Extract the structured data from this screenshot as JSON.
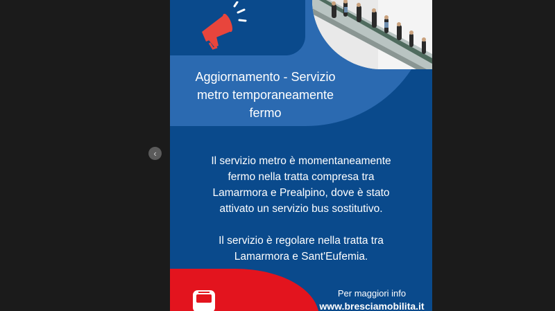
{
  "viewer": {
    "prev_icon": "chevron-left-icon",
    "prev_glyph": "‹"
  },
  "post": {
    "title": "Aggiornamento - Servizio\nmetro temporaneamente\nfermo",
    "body": "Il servizio metro è momentaneamente\nfermo nella tratta compresa tra\nLamarmora e Prealpino, dove è stato\nattivato un servizio bus sostitutivo.\n\nIl servizio è regolare nella tratta tra\nLamarmora e Sant'Eufemia.",
    "info_label": "Per maggiori info",
    "info_url": "www.bresciamobilita.it",
    "icons": {
      "announcement": "megaphone-icon",
      "transport": "bus-icon"
    },
    "colors": {
      "background": "#0a4a8c",
      "band": "#2b6ab1",
      "accent_red": "#e3141e",
      "megaphone": "#e8453c"
    }
  }
}
